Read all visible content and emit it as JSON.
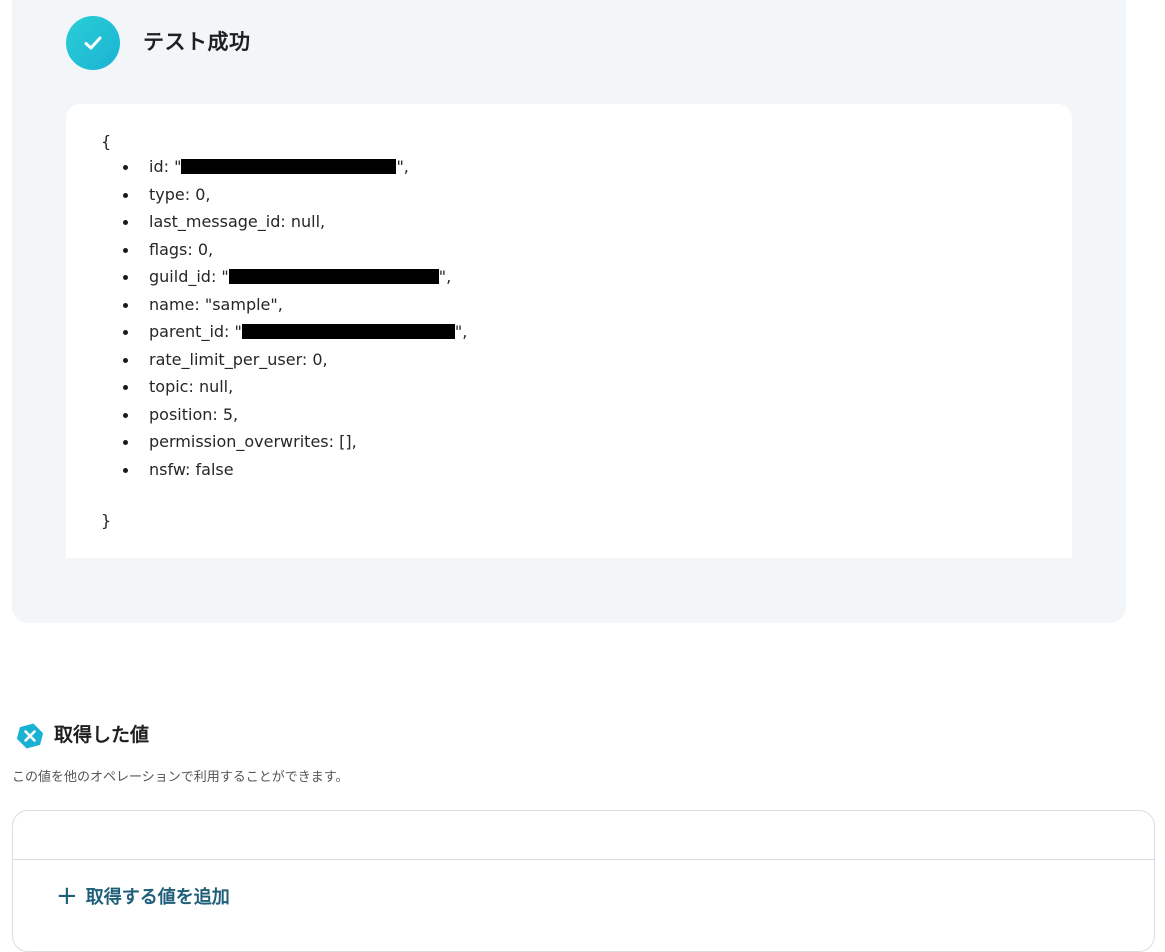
{
  "test_result": {
    "status_title": "テスト成功",
    "brace_open": "{",
    "brace_close": "}",
    "fields": [
      {
        "prefix": "id: \"",
        "redacted": true,
        "suffix": "\","
      },
      {
        "prefix": "type: 0,",
        "redacted": false,
        "suffix": ""
      },
      {
        "prefix": "last_message_id: null,",
        "redacted": false,
        "suffix": ""
      },
      {
        "prefix": "flags: 0,",
        "redacted": false,
        "suffix": ""
      },
      {
        "prefix": "guild_id: \"",
        "redacted": true,
        "suffix": "\","
      },
      {
        "prefix": "name: \"sample\",",
        "redacted": false,
        "suffix": ""
      },
      {
        "prefix": "parent_id: \"",
        "redacted": true,
        "suffix": "\","
      },
      {
        "prefix": "rate_limit_per_user: 0,",
        "redacted": false,
        "suffix": ""
      },
      {
        "prefix": "topic: null,",
        "redacted": false,
        "suffix": ""
      },
      {
        "prefix": "position: 5,",
        "redacted": false,
        "suffix": ""
      },
      {
        "prefix": "permission_overwrites: [],",
        "redacted": false,
        "suffix": ""
      },
      {
        "prefix": "nsfw: false",
        "redacted": false,
        "suffix": ""
      }
    ]
  },
  "acquired_values": {
    "title": "取得した値",
    "description": "この値を他のオペレーションで利用することができます。",
    "add_button_label": "取得する値を追加"
  },
  "icons": {
    "success": "check-icon",
    "variable": "variable-x-icon",
    "add": "plus-icon"
  },
  "colors": {
    "accent": "#1ab2d3",
    "panel_bg": "#f2f6f9",
    "link": "#1f5f79"
  }
}
